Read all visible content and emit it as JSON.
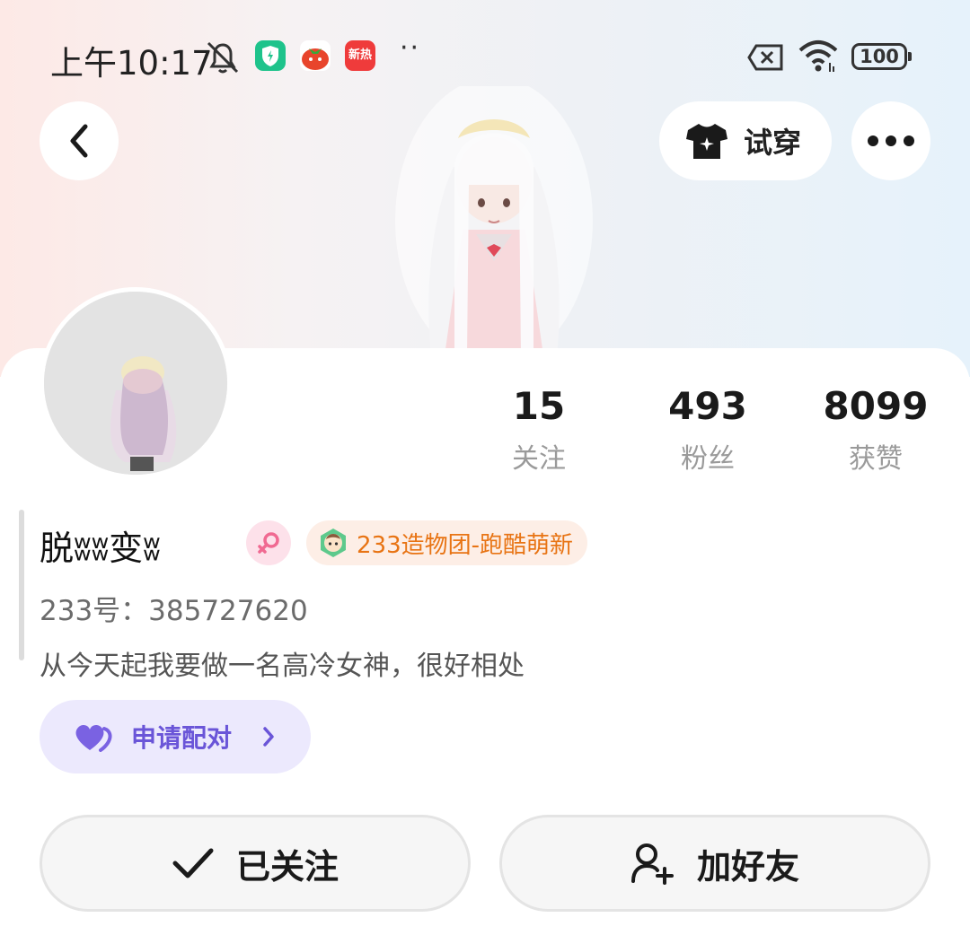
{
  "status_bar": {
    "time": "上午10:17",
    "app_badge_3": "新热",
    "more_dots": "··",
    "battery": "100"
  },
  "header": {
    "tryon_label": "试穿"
  },
  "profile": {
    "name": "脱ʬʬ变ʬ",
    "tag": "233造物团-跑酷萌新",
    "uid": "233号：385727620",
    "bio": "从今天起我要做一名高冷女神，很好相处"
  },
  "stats": [
    {
      "value": "15",
      "label": "关注"
    },
    {
      "value": "493",
      "label": "粉丝"
    },
    {
      "value": "8099",
      "label": "获赞"
    }
  ],
  "pair": {
    "label": "申请配对"
  },
  "actions": {
    "followed_label": "已关注",
    "add_friend_label": "加好友"
  },
  "colors": {
    "accent_purple": "#6a55d8",
    "tag_orange": "#e87414",
    "gender_pink": "#f06a92"
  }
}
